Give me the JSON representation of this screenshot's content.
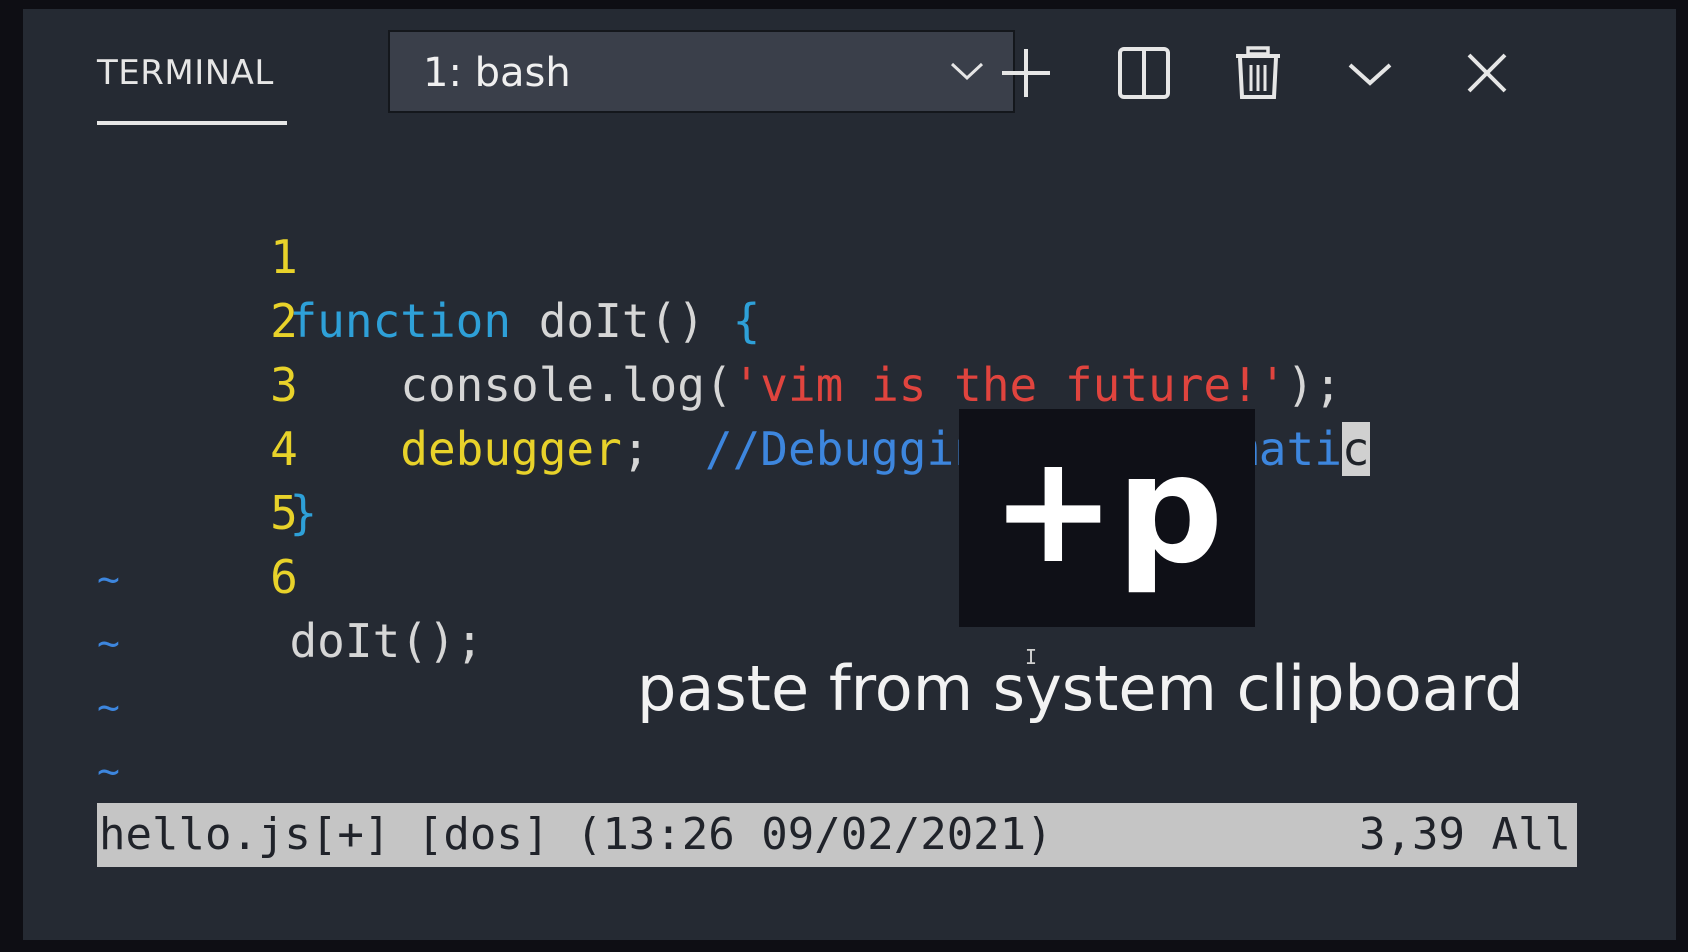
{
  "header": {
    "tab_label": "TERMINAL",
    "terminal_select": {
      "selected": "1: bash"
    },
    "icons": [
      "plus-icon",
      "split-icon",
      "trash-icon",
      "chevron-down-icon",
      "close-icon"
    ]
  },
  "editor": {
    "lines": [
      {
        "number": "1",
        "t1": "function",
        "t2": " doIt() ",
        "t3": "{"
      },
      {
        "number": "2",
        "t1": "    console.log(",
        "t2": "'vim is the future!'",
        "t3": ");"
      },
      {
        "number": "3",
        "t1": "    debugger",
        "t2": ";  ",
        "t3": "//Debugging is automati",
        "cursor": "c"
      },
      {
        "number": "4",
        "t1": "}"
      },
      {
        "number": "5"
      },
      {
        "number": "6",
        "t1": "doIt();"
      }
    ],
    "empty_markers": [
      "~",
      "~",
      "~",
      "~"
    ]
  },
  "statusline": {
    "left": "hello.js[+] [dos] (13:26 09/02/2021)",
    "right": "3,39 All"
  },
  "overlay": {
    "key": "+p",
    "caption": "paste from system clipboard"
  },
  "colors": {
    "background": "#252a33",
    "line_number": "#e8d22a",
    "keyword": "#2ea0d8",
    "string": "#e0443e",
    "comment": "#3d86de",
    "statusline_bg": "#c5c5c5"
  }
}
